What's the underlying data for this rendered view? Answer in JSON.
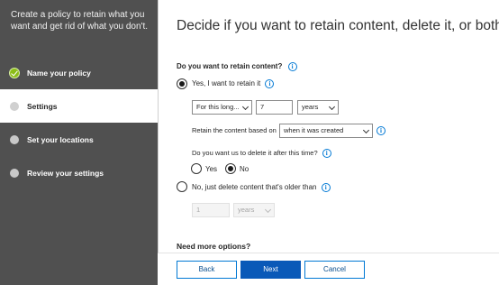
{
  "wizard": {
    "title": "Create a policy to retain what you want and get rid of what you don't.",
    "steps": [
      {
        "label": "Name your policy",
        "state": "done"
      },
      {
        "label": "Settings",
        "state": "active"
      },
      {
        "label": "Set your locations",
        "state": "pending"
      },
      {
        "label": "Review your settings",
        "state": "pending"
      }
    ]
  },
  "main": {
    "title": "Decide if you want to retain content, delete it, or both",
    "retain_question": "Do you want to retain content?",
    "option_yes_retain": "Yes, I want to retain it",
    "retention_period_select": "For this long...",
    "retention_value": "7",
    "retention_unit_select": "years",
    "based_on_label": "Retain the content based on",
    "based_on_select": "when it was created",
    "delete_question": "Do you want us to delete it after this time?",
    "delete_yes": "Yes",
    "delete_no": "No",
    "option_delete_older": "No, just delete content that's older than",
    "older_value": "1",
    "older_unit_select": "years",
    "more_options": "Need more options?"
  },
  "footer": {
    "back": "Back",
    "next": "Next",
    "cancel": "Cancel"
  },
  "icons": {
    "info": "info-icon",
    "check": "check-icon",
    "chevron": "chevron-down-icon"
  },
  "colors": {
    "sidebar_bg": "#505050",
    "accent": "#0a59b8",
    "done_step": "#8cbd18"
  }
}
